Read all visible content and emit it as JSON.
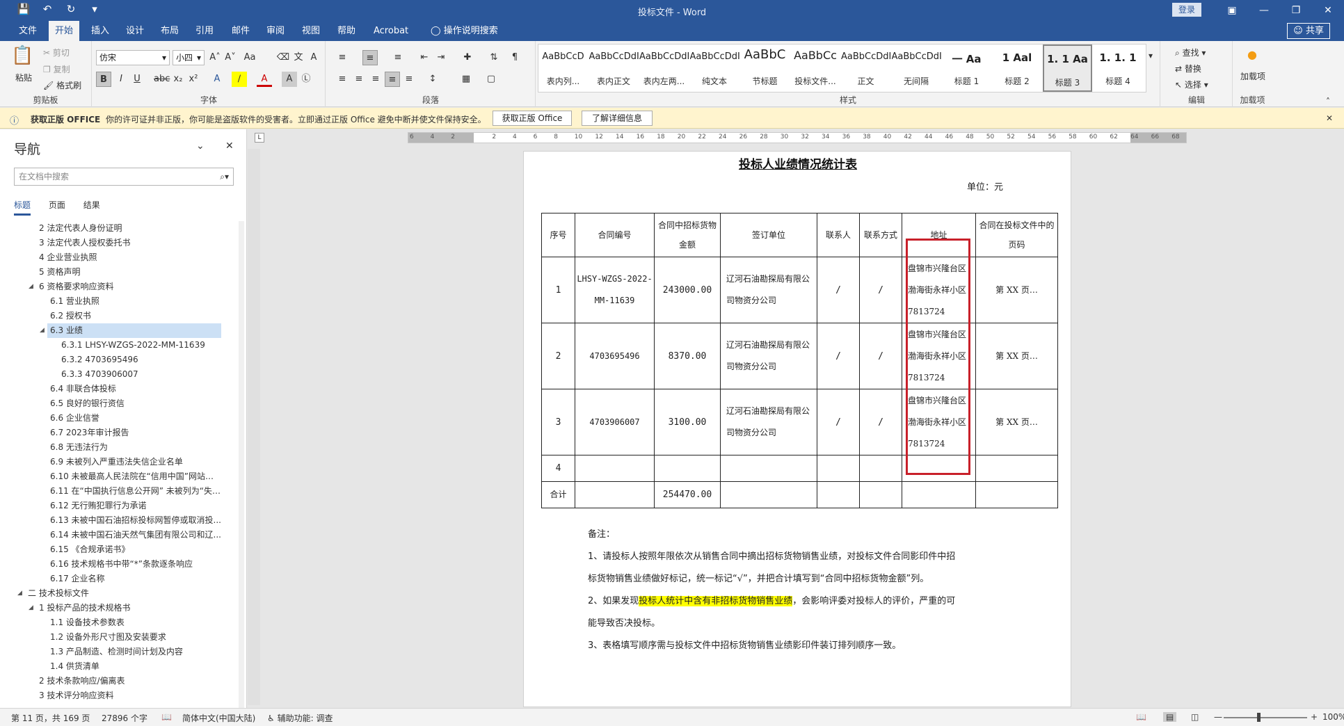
{
  "titlebar": {
    "title": "投标文件  -  Word",
    "login": "登录",
    "save_icon": "save-icon",
    "undo_icon": "undo-icon",
    "redo_icon": "redo-icon"
  },
  "tabs": [
    "文件",
    "开始",
    "插入",
    "设计",
    "布局",
    "引用",
    "邮件",
    "审阅",
    "视图",
    "帮助",
    "Acrobat"
  ],
  "tell_me": "操作说明搜索",
  "share": "共享",
  "ribbon": {
    "clipboard": {
      "paste": "粘贴",
      "cut": "剪切",
      "copy": "复制",
      "format_painter": "格式刷",
      "label": "剪贴板"
    },
    "font": {
      "name": "仿宋",
      "size": "小四",
      "label": "字体"
    },
    "paragraph": {
      "label": "段落"
    },
    "styles": {
      "label": "样式",
      "items": [
        {
          "preview": "AaBbCcD",
          "name": "表内列..."
        },
        {
          "preview": "AaBbCcDdI",
          "name": "表内正文"
        },
        {
          "preview": "AaBbCcDdEe",
          "name": "表内左两..."
        },
        {
          "preview": "AaBbCcDdI",
          "name": "纯文本"
        },
        {
          "preview": "AaBbC",
          "name": "节标题"
        },
        {
          "preview": "AaBbCc",
          "name": "投标文件..."
        },
        {
          "preview": "AaBbCcDdI",
          "name": "正文"
        },
        {
          "preview": "AaBbCcDdI",
          "name": "无间隔"
        },
        {
          "preview": "一  Aa",
          "name": "标题 1"
        },
        {
          "preview": "1  Aal",
          "name": "标题 2"
        },
        {
          "preview": "1. 1  Aa",
          "name": "标题 3"
        },
        {
          "preview": "1. 1. 1",
          "name": "标题 4"
        }
      ]
    },
    "editing": {
      "find": "查找",
      "replace": "替换",
      "select": "选择",
      "label": "编辑"
    },
    "addins": {
      "label": "加载项",
      "button": "加载项"
    }
  },
  "notice": {
    "title": "获取正版 OFFICE",
    "text": "你的许可证并非正版，你可能是盗版软件的受害者。立即通过正版 Office 避免中断并使文件保持安全。",
    "btn1": "获取正版 Office",
    "btn2": "了解详细信息"
  },
  "nav": {
    "title": "导航",
    "search_placeholder": "在文档中搜索",
    "tabs": [
      "标题",
      "页面",
      "结果"
    ],
    "items": [
      {
        "level": 2,
        "text": "2 法定代表人身份证明"
      },
      {
        "level": 2,
        "text": "3 法定代表人授权委托书"
      },
      {
        "level": 2,
        "text": "4 企业营业执照"
      },
      {
        "level": 2,
        "text": "5 资格声明"
      },
      {
        "level": 2,
        "text": "6 资格要求响应资料",
        "expanded": true
      },
      {
        "level": 3,
        "text": "6.1 营业执照"
      },
      {
        "level": 3,
        "text": "6.2 授权书"
      },
      {
        "level": 3,
        "text": "6.3 业绩",
        "expanded": true,
        "selected": true
      },
      {
        "level": 4,
        "text": "6.3.1 LHSY-WZGS-2022-MM-11639"
      },
      {
        "level": 4,
        "text": "6.3.2 4703695496"
      },
      {
        "level": 4,
        "text": "6.3.3 4703906007"
      },
      {
        "level": 3,
        "text": "6.4 非联合体投标"
      },
      {
        "level": 3,
        "text": "6.5 良好的银行资信"
      },
      {
        "level": 3,
        "text": "6.6 企业信誉"
      },
      {
        "level": 3,
        "text": "6.7 2023年审计报告"
      },
      {
        "level": 3,
        "text": "6.8 无违法行为"
      },
      {
        "level": 3,
        "text": "6.9 未被列入严重违法失信企业名单"
      },
      {
        "level": 3,
        "text": "6.10 未被最高人民法院在“信用中国”网站或..."
      },
      {
        "level": 3,
        "text": "6.11 在“中国执行信息公开网” 未被列为“失信..."
      },
      {
        "level": 3,
        "text": "6.12 无行贿犯罪行为承诺"
      },
      {
        "level": 3,
        "text": "6.13 未被中国石油招标投标网暂停或取消投..."
      },
      {
        "level": 3,
        "text": "6.14 未被中国石油天然气集团有限公司和辽..."
      },
      {
        "level": 3,
        "text": "6.15 《合规承诺书》"
      },
      {
        "level": 3,
        "text": "6.16 技术规格书中带“*”条款逐条响应"
      },
      {
        "level": 3,
        "text": "6.17 企业名称"
      },
      {
        "level": 1,
        "text": "二 技术投标文件",
        "expanded": true
      },
      {
        "level": 2,
        "text": "1 投标产品的技术规格书",
        "expanded": true
      },
      {
        "level": 3,
        "text": "1.1 设备技术参数表"
      },
      {
        "level": 3,
        "text": "1.2 设备外形尺寸图及安装要求"
      },
      {
        "level": 3,
        "text": "1.3   产品制造、检测时间计划及内容"
      },
      {
        "level": 3,
        "text": "1.4   供货清单"
      },
      {
        "level": 2,
        "text": "2 技术条款响应/偏离表"
      },
      {
        "level": 2,
        "text": "3 技术评分响应资料"
      }
    ]
  },
  "ruler_numbers": [
    "6",
    "4",
    "2",
    "",
    "2",
    "4",
    "6",
    "8",
    "10",
    "12",
    "14",
    "16",
    "18",
    "20",
    "22",
    "24",
    "26",
    "28",
    "30",
    "32",
    "34",
    "36",
    "38",
    "40",
    "42",
    "44",
    "46",
    "48",
    "50",
    "52",
    "54",
    "56",
    "58",
    "60",
    "62",
    "64",
    "66",
    "68"
  ],
  "document": {
    "title": "投标人业绩情况统计表",
    "unit": "单位：元",
    "headers": [
      "序号",
      "合同编号",
      "合同中招标货物金额",
      "签订单位",
      "联系人",
      "联系方式",
      "地址",
      "合同在投标文件中的页码"
    ],
    "rows": [
      [
        "1",
        "LHSY-WZGS-2022-MM-11639",
        "243000.00",
        "辽河石油勘探局有限公司物资分公司",
        "/",
        "/",
        "盘锦市兴隆台区渤海街永祥小区 7813724",
        "第 XX 页…"
      ],
      [
        "2",
        "4703695496",
        "8370.00",
        "辽河石油勘探局有限公司物资分公司",
        "/",
        "/",
        "盘锦市兴隆台区渤海街永祥小区 7813724",
        "第 XX 页…"
      ],
      [
        "3",
        "4703906007",
        "3100.00",
        "辽河石油勘探局有限公司物资分公司",
        "/",
        "/",
        "盘锦市兴隆台区渤海街永祥小区 7813724",
        "第 XX 页…"
      ],
      [
        "4",
        "",
        "",
        "",
        "",
        "",
        "",
        ""
      ],
      [
        "合计",
        "",
        "254470.00",
        "",
        "",
        "",
        "",
        ""
      ]
    ],
    "notes": {
      "heading": "备注：",
      "n1a": "1、请投标人按照年限依次从销售合同中摘出招标货物销售业绩，对投标文件合同影印件中招",
      "n1b": "标货物销售业绩做好标记，统一标记“√”，并把合计填写到“合同中招标货物金额”列。",
      "n2a_pre": "2、如果发现",
      "n2a_hl": "投标人统计中含有非招标货物销售业绩",
      "n2a_post": "，会影响评委对投标人的评价，严重的可",
      "n2b": "能导致否决投标。",
      "n3": "3、表格填写顺序需与投标文件中招标货物销售业绩影印件装订排列顺序一致。"
    }
  },
  "statusbar": {
    "page": "第 11 页，共 169 页",
    "words": "27896 个字",
    "lang": "简体中文(中国大陆)",
    "accessibility": "辅助功能: 调查",
    "zoom": "100%"
  },
  "colors": {
    "accent": "#2b579a",
    "notice_bg": "#fff4ce",
    "highlight": "#ffff00",
    "redbox": "#c8202a"
  }
}
